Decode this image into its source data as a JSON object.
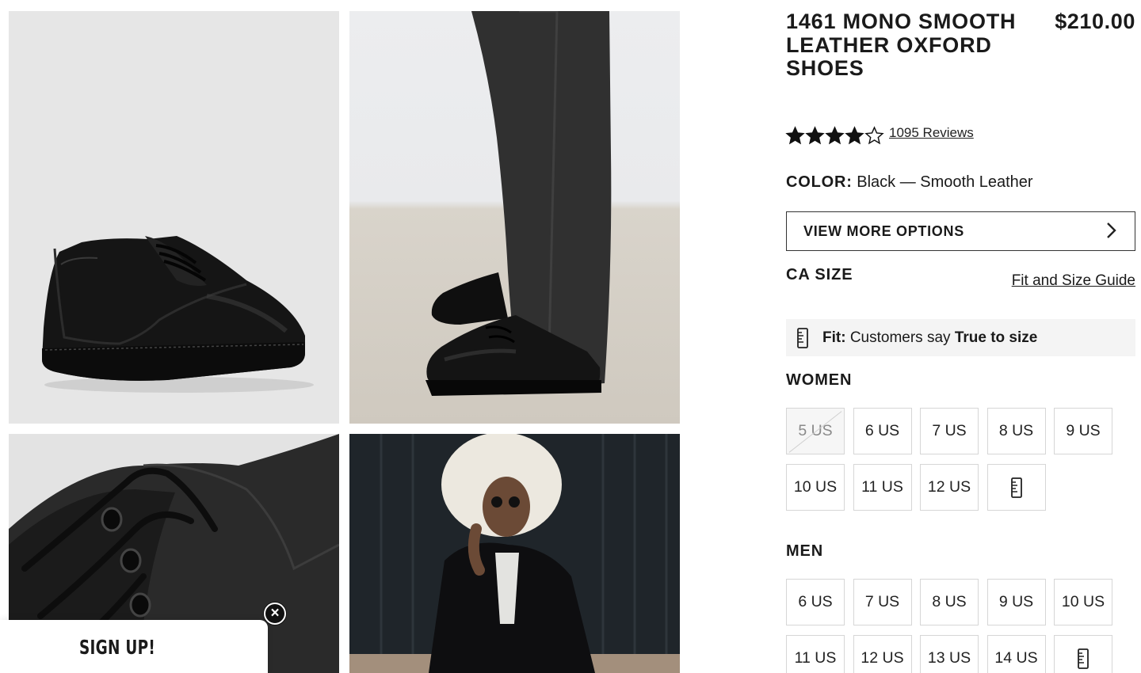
{
  "product": {
    "title": "1461 MONO SMOOTH LEATHER OXFORD SHOES",
    "price": "$210.00",
    "rating": 4,
    "rating_max": 5,
    "reviews_text": "1095 Reviews",
    "color_label": "COLOR:",
    "color_value": "Black — Smooth Leather",
    "view_more_label": "VIEW MORE OPTIONS"
  },
  "sizing": {
    "heading": "CA SIZE",
    "guide_link": "Fit and Size Guide",
    "fit_label": "Fit:",
    "fit_text": "Customers say",
    "fit_value": "True to size",
    "groups": [
      {
        "heading": "WOMEN",
        "sizes": [
          {
            "label": "5 US",
            "available": false
          },
          {
            "label": "6 US",
            "available": true
          },
          {
            "label": "7 US",
            "available": true
          },
          {
            "label": "8 US",
            "available": true
          },
          {
            "label": "9 US",
            "available": true
          },
          {
            "label": "10 US",
            "available": true
          },
          {
            "label": "11 US",
            "available": true
          },
          {
            "label": "12 US",
            "available": true
          }
        ]
      },
      {
        "heading": "MEN",
        "sizes": [
          {
            "label": "6 US",
            "available": true
          },
          {
            "label": "7 US",
            "available": true
          },
          {
            "label": "8 US",
            "available": true
          },
          {
            "label": "9 US",
            "available": true
          },
          {
            "label": "10 US",
            "available": true
          },
          {
            "label": "11 US",
            "available": true
          },
          {
            "label": "12 US",
            "available": true
          },
          {
            "label": "13 US",
            "available": true
          },
          {
            "label": "14 US",
            "available": true
          }
        ]
      }
    ]
  },
  "popup": {
    "label": "SIGN UP!"
  },
  "icons": {
    "star": "star-icon",
    "chevron": "chevron-right-icon",
    "ruler": "ruler-icon",
    "close": "close-icon"
  }
}
